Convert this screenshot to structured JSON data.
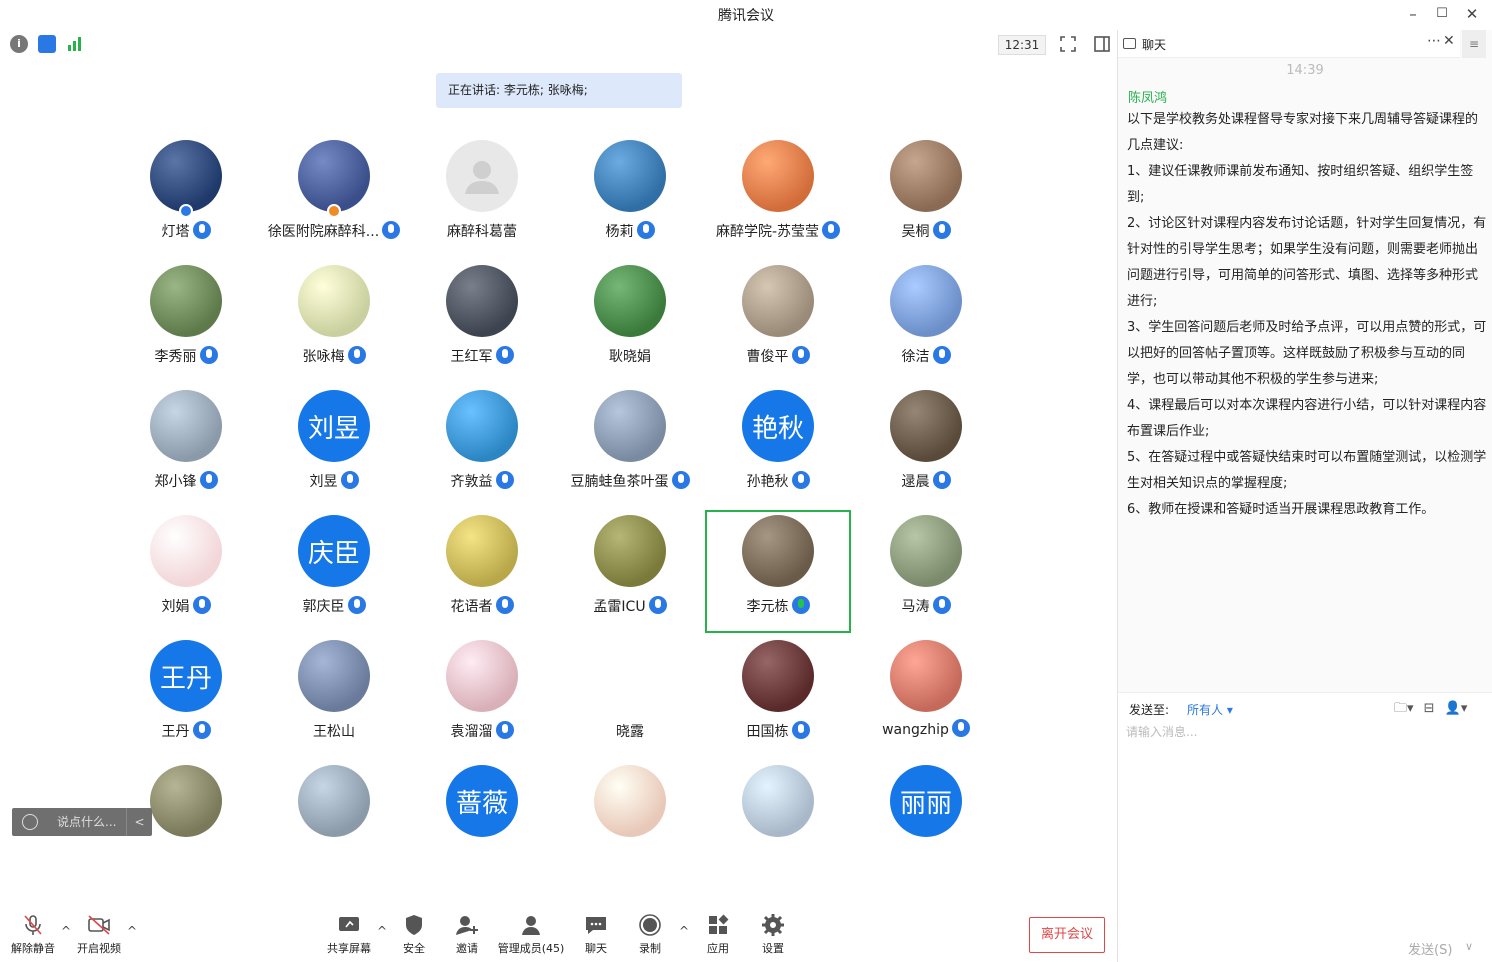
{
  "window": {
    "title": "腾讯会议",
    "minimize": "–",
    "maximize": "☐",
    "close": "✕"
  },
  "toolbar": {
    "time": "12:31"
  },
  "speaking_banner": "正在讲话: 李元栋; 张咏梅;",
  "participants": [
    {
      "name": "灯塔",
      "avatar": "photo",
      "color": "#1f3a6a",
      "mic": "on",
      "badge": "host"
    },
    {
      "name": "徐医附院麻醉科...",
      "avatar": "photo",
      "color": "#3a4f8a",
      "mic": "on",
      "badge": "cohost"
    },
    {
      "name": "麻醉科葛蕾",
      "avatar": "default",
      "color": "#e8e8e8",
      "mic": "none"
    },
    {
      "name": "杨莉",
      "avatar": "photo",
      "color": "#2f6fa5",
      "mic": "on"
    },
    {
      "name": "麻醉学院-苏莹莹",
      "avatar": "photo",
      "color": "#d26d3a",
      "mic": "on"
    },
    {
      "name": "吴桐",
      "avatar": "photo",
      "color": "#8a6a52",
      "mic": "on"
    },
    {
      "name": "李秀丽",
      "avatar": "photo",
      "color": "#5f7a4a",
      "mic": "on"
    },
    {
      "name": "张咏梅",
      "avatar": "photo",
      "color": "#c9cf9e",
      "mic": "on"
    },
    {
      "name": "王红军",
      "avatar": "photo",
      "color": "#3d4450",
      "mic": "on"
    },
    {
      "name": "耿晓娟",
      "avatar": "photo",
      "color": "#3a7a3a",
      "mic": "none"
    },
    {
      "name": "曹俊平",
      "avatar": "photo",
      "color": "#9a8a78",
      "mic": "on"
    },
    {
      "name": "徐洁",
      "avatar": "photo",
      "color": "#6d8fc9",
      "mic": "on"
    },
    {
      "name": "郑小锋",
      "avatar": "photo",
      "color": "#8a9aa8",
      "mic": "on"
    },
    {
      "name": "刘昱",
      "avatar": "initials",
      "initials": "刘昱",
      "mic": "on"
    },
    {
      "name": "齐敦益",
      "avatar": "photo",
      "color": "#2d86c4",
      "mic": "on"
    },
    {
      "name": "豆腩蛙鱼茶叶蛋",
      "avatar": "photo",
      "color": "#7a8aa0",
      "mic": "on"
    },
    {
      "name": "孙艳秋",
      "avatar": "initials",
      "initials": "艳秋",
      "mic": "on"
    },
    {
      "name": "逯晨",
      "avatar": "photo",
      "color": "#5a4a3a",
      "mic": "on"
    },
    {
      "name": "刘娟",
      "avatar": "photo",
      "color": "#f2d6d8",
      "mic": "on"
    },
    {
      "name": "郭庆臣",
      "avatar": "initials",
      "initials": "庆臣",
      "mic": "on"
    },
    {
      "name": "花语者",
      "avatar": "photo",
      "color": "#b9a84a",
      "mic": "on"
    },
    {
      "name": "孟雷ICU",
      "avatar": "photo",
      "color": "#7a7a3a",
      "mic": "on"
    },
    {
      "name": "李元栋",
      "avatar": "photo",
      "color": "#6a5a48",
      "mic": "active"
    },
    {
      "name": "马涛",
      "avatar": "photo",
      "color": "#7a8a6a",
      "mic": "on"
    },
    {
      "name": "王丹",
      "avatar": "initials",
      "initials": "王丹",
      "mic": "on"
    },
    {
      "name": "王松山",
      "avatar": "photo",
      "color": "#6a7a9a",
      "mic": "none"
    },
    {
      "name": "袁溜溜",
      "avatar": "photo",
      "color": "#d9b0b8",
      "mic": "on"
    },
    {
      "name": "晓露",
      "avatar": "photo",
      "color": "#ffffff",
      "mic": "none"
    },
    {
      "name": "田国栋",
      "avatar": "photo",
      "color": "#5a2a2a",
      "mic": "on"
    },
    {
      "name": "wangzhip",
      "avatar": "photo",
      "color": "#c56a5a",
      "mic": "on"
    },
    {
      "name": "",
      "avatar": "photo",
      "color": "#7a7a5a",
      "mic": "none"
    },
    {
      "name": "",
      "avatar": "photo",
      "color": "#8a9aa8",
      "mic": "none"
    },
    {
      "name": "",
      "avatar": "initials",
      "initials": "蔷薇",
      "mic": "none"
    },
    {
      "name": "",
      "avatar": "photo",
      "color": "#e8c8b8",
      "mic": "none"
    },
    {
      "name": "",
      "avatar": "photo",
      "color": "#a8b8c8",
      "mic": "none"
    },
    {
      "name": "",
      "avatar": "initials",
      "initials": "丽丽",
      "mic": "none"
    }
  ],
  "quick_chat": {
    "placeholder": "说点什么...",
    "arrow": "<"
  },
  "bottom_toolbar": {
    "unmute": "解除静音",
    "start_video": "开启视频",
    "share_screen": "共享屏幕",
    "security": "安全",
    "invite": "邀请",
    "members": "管理成员(45)",
    "chat": "聊天",
    "record": "录制",
    "apps": "应用",
    "settings": "设置",
    "leave": "离开会议"
  },
  "chat": {
    "title": "聊天",
    "time": "14:39",
    "sender": "陈凤鸿",
    "lines": [
      "以下是学校教务处课程督导专家对接下来几周辅导答疑课程的几点建议:",
      "1、建议任课教师课前发布通知、按时组织答疑、组织学生签到;",
      "2、讨论区针对课程内容发布讨论话题，针对学生回复情况，有针对性的引导学生思考；如果学生没有问题，则需要老师抛出问题进行引导，可用简单的问答形式、填图、选择等多种形式进行;",
      "3、学生回答问题后老师及时给予点评，可以用点赞的形式，可以把好的回答帖子置顶等。这样既鼓励了积极参与互动的同学，也可以带动其他不积极的学生参与进来;",
      "4、课程最后可以对本次课程内容进行小结，可以针对课程内容布置课后作业;",
      "5、在答疑过程中或答疑快结束时可以布置随堂测试，以检测学生对相关知识点的掌握程度;",
      "6、教师在授课和答疑时适当开展课程思政教育工作。"
    ],
    "send_to_label": "发送至:",
    "send_to_target": "所有人",
    "input_placeholder": "请输入消息...",
    "send_button": "发送(S)"
  }
}
